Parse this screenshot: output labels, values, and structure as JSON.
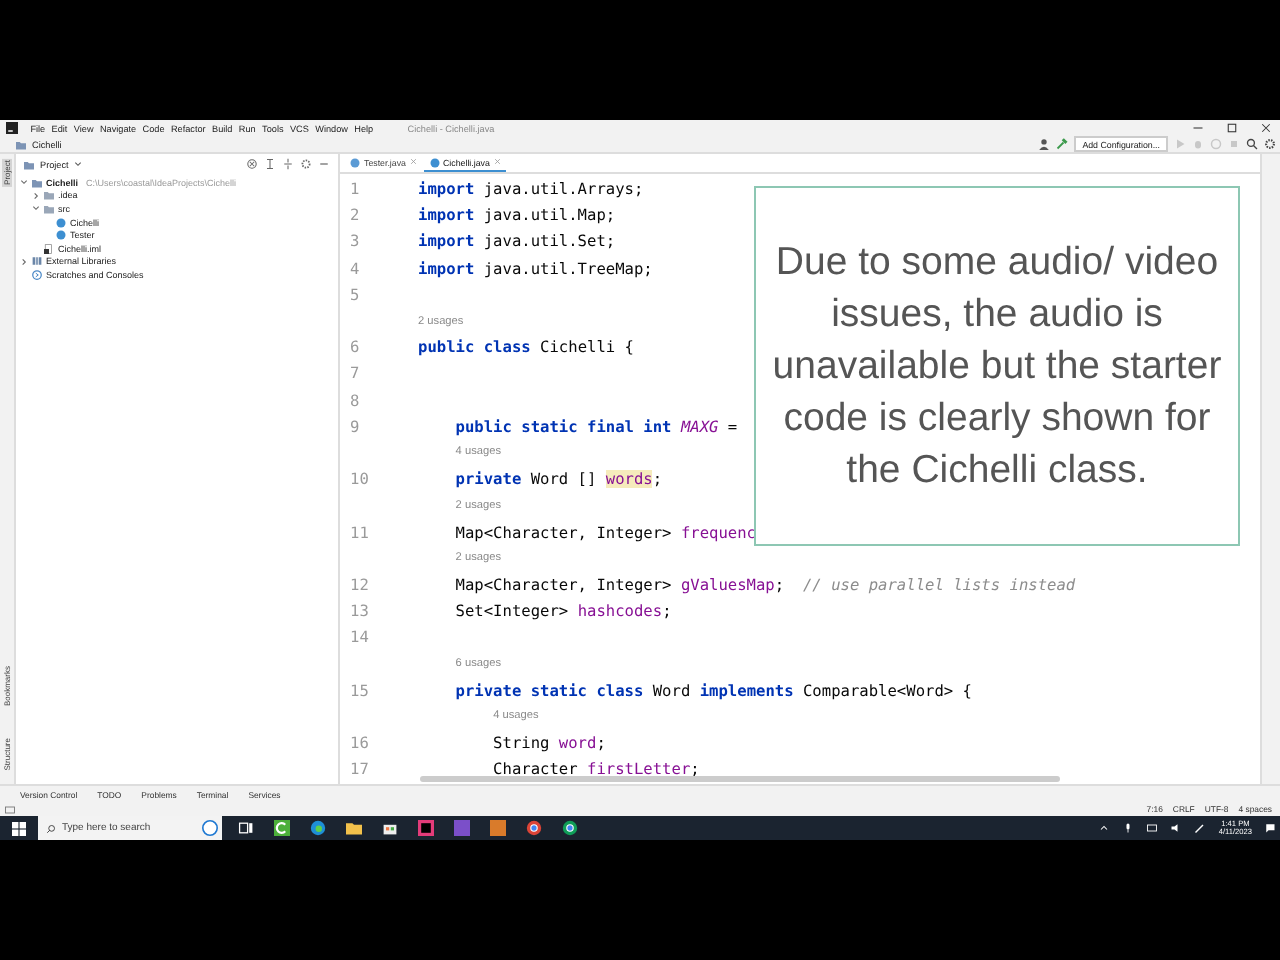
{
  "menu_bar": {
    "items": [
      "File",
      "Edit",
      "View",
      "Navigate",
      "Code",
      "Refactor",
      "Build",
      "Run",
      "Tools",
      "VCS",
      "Window",
      "Help"
    ],
    "title": "Cichelli - Cichelli.java"
  },
  "navigation_bar": {
    "breadcrumb": "Cichelli",
    "run_configuration": "Add Configuration..."
  },
  "left_stripe": [
    "Project",
    "Bookmarks",
    "Structure"
  ],
  "project_panel": {
    "title": "Project",
    "tree": [
      {
        "label": "Cichelli",
        "kind": "project",
        "path": "C:\\Users\\coastal\\IdeaProjects\\Cichelli",
        "expanded": true,
        "children": [
          {
            "label": ".idea",
            "kind": "folder",
            "expanded": false
          },
          {
            "label": "src",
            "kind": "folder",
            "expanded": true,
            "children": [
              {
                "label": "Cichelli",
                "kind": "class"
              },
              {
                "label": "Tester",
                "kind": "class"
              }
            ]
          },
          {
            "label": "Cichelli.iml",
            "kind": "file"
          }
        ]
      },
      {
        "label": "External Libraries",
        "kind": "library",
        "expanded": false
      },
      {
        "label": "Scratches and Consoles",
        "kind": "scratches"
      }
    ]
  },
  "editor": {
    "tabs": [
      {
        "label": "Tester.java",
        "selected": false
      },
      {
        "label": "Cichelli.java",
        "selected": true
      }
    ],
    "lines": [
      {
        "number": "1",
        "segments": [
          {
            "kind": "kw",
            "text": "import"
          },
          {
            "kind": "plain",
            "text": " java.util.Arrays;"
          }
        ]
      },
      {
        "number": "2",
        "segments": [
          {
            "kind": "kw",
            "text": "import"
          },
          {
            "kind": "plain",
            "text": " java.util.Map;"
          }
        ]
      },
      {
        "number": "3",
        "segments": [
          {
            "kind": "kw",
            "text": "import"
          },
          {
            "kind": "plain",
            "text": " java.util.Set;"
          }
        ]
      },
      {
        "number": "4",
        "segments": [
          {
            "kind": "kw",
            "text": "import"
          },
          {
            "kind": "plain",
            "text": " java.util.TreeMap;"
          }
        ]
      },
      {
        "number": "5"
      },
      {
        "number": "6",
        "usages": "2 usages",
        "segments": [
          {
            "kind": "kw",
            "text": "public class"
          },
          {
            "kind": "plain",
            "text": " Cichelli {"
          }
        ]
      },
      {
        "number": "7"
      },
      {
        "number": "8"
      },
      {
        "number": "9",
        "segments": [
          {
            "kind": "kw",
            "text": "    public static final int "
          },
          {
            "kind": "const",
            "text": "MAXG"
          },
          {
            "kind": "plain",
            "text": " ="
          }
        ]
      },
      {
        "number": "10",
        "usages": "4 usages",
        "segments": [
          {
            "kind": "kw",
            "text": "    private"
          },
          {
            "kind": "plain",
            "text": " Word [] "
          },
          {
            "kind": "hl",
            "text": "words"
          },
          {
            "kind": "plain",
            "text": ";"
          }
        ]
      },
      {
        "number": "11",
        "usages": "2 usages",
        "segments": [
          {
            "kind": "plain",
            "text": "    Map<Character, Integer> "
          },
          {
            "kind": "field",
            "text": "frequenc"
          }
        ]
      },
      {
        "number": "12",
        "usages": "2 usages",
        "segments": [
          {
            "kind": "plain",
            "text": "    Map<Character, Integer> "
          },
          {
            "kind": "field",
            "text": "gValuesMap"
          },
          {
            "kind": "plain",
            "text": ";  "
          },
          {
            "kind": "comment",
            "text": "// use parallel lists instead"
          }
        ]
      },
      {
        "number": "13",
        "segments": [
          {
            "kind": "plain",
            "text": "    Set<Integer> "
          },
          {
            "kind": "field",
            "text": "hashcodes"
          },
          {
            "kind": "plain",
            "text": ";"
          }
        ]
      },
      {
        "number": "14"
      },
      {
        "number": "15",
        "usages": "6 usages",
        "segments": [
          {
            "kind": "kw",
            "text": "    private static class"
          },
          {
            "kind": "plain",
            "text": " Word "
          },
          {
            "kind": "kw",
            "text": "implements"
          },
          {
            "kind": "plain",
            "text": " Comparable<Word> {"
          }
        ]
      },
      {
        "number": "16",
        "usages": "4 usages",
        "segments": [
          {
            "kind": "plain",
            "text": "        String "
          },
          {
            "kind": "field",
            "text": "word"
          },
          {
            "kind": "plain",
            "text": ";"
          }
        ]
      },
      {
        "number": "17",
        "segments": [
          {
            "kind": "plain",
            "text": "        Character "
          },
          {
            "kind": "field",
            "text": "firstLetter"
          },
          {
            "kind": "plain",
            "text": ";"
          }
        ]
      }
    ]
  },
  "note": "Due to some audio/ video issues, the audio is unavailable but the starter code is clearly shown for the Cichelli class.",
  "tool_window_bar": [
    "Version Control",
    "TODO",
    "Problems",
    "Terminal",
    "Services"
  ],
  "status_bar": [
    "7:16",
    "CRLF",
    "UTF-8",
    "4 spaces"
  ],
  "taskbar": {
    "search_placeholder": "Type here to search",
    "time": "1:41 PM",
    "date": "4/11/2023"
  }
}
